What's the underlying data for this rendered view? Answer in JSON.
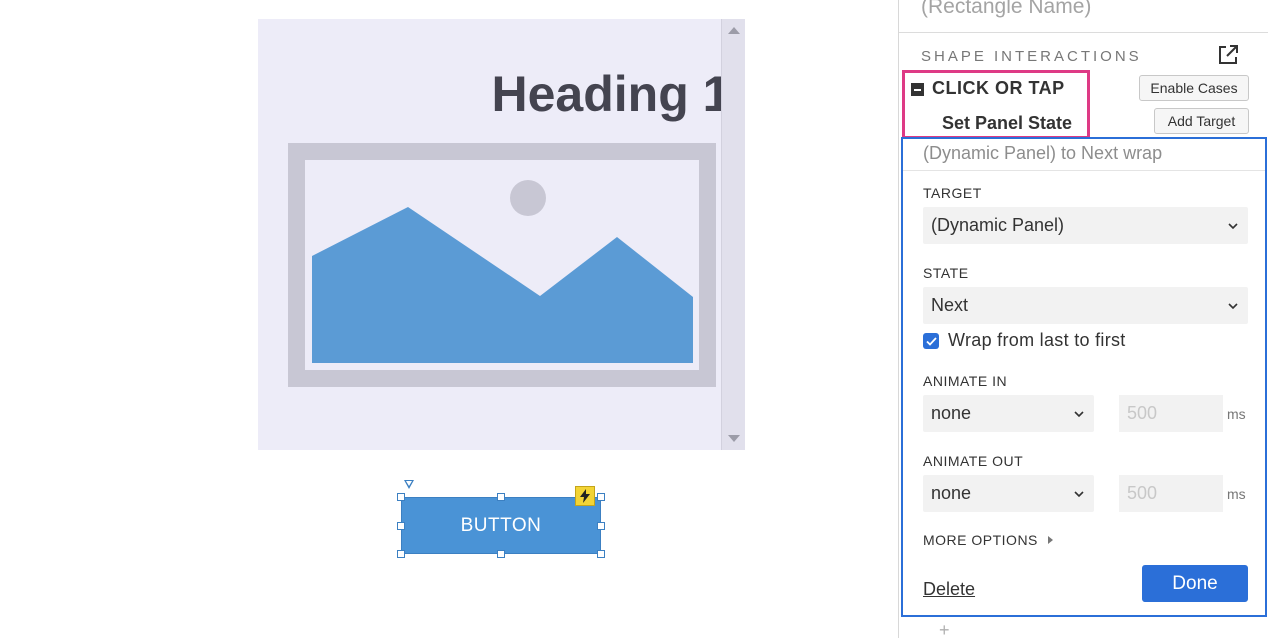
{
  "canvas": {
    "dynamic_panel": {
      "heading": "Heading 1"
    },
    "button": {
      "label": "BUTTON"
    }
  },
  "right_panel": {
    "shape_name_placeholder": "(Rectangle Name)",
    "section_title": "SHAPE INTERACTIONS",
    "event": {
      "label": "CLICK OR TAP",
      "action": "Set Panel State"
    },
    "enable_cases_label": "Enable Cases",
    "add_target_label": "Add Target",
    "editor": {
      "summary": "(Dynamic Panel) to Next wrap",
      "target_label": "TARGET",
      "target_value": "(Dynamic Panel)",
      "state_label": "STATE",
      "state_value": "Next",
      "wrap_checked": true,
      "wrap_label": "Wrap from last to first",
      "animate_in_label": "ANIMATE IN",
      "animate_in_value": "none",
      "animate_in_ms": "500",
      "animate_out_label": "ANIMATE OUT",
      "animate_out_value": "none",
      "animate_out_ms": "500",
      "ms_unit": "ms",
      "more_options_label": "MORE OPTIONS",
      "delete_label": "Delete",
      "done_label": "Done"
    },
    "add_plus": "+"
  },
  "colors": {
    "accent_blue": "#2b6fd8",
    "highlight_pink": "#de3a85",
    "widget_blue": "#4a93d6",
    "panel_bg": "#edecf8",
    "image_blue": "#5b9bd5",
    "badge_yellow": "#f3d435"
  },
  "icons": {
    "popout": "external-link-icon",
    "collapse": "minus-square-icon",
    "chevron": "chevron-down-icon",
    "check": "check-icon",
    "interaction_badge": "lightning-bolt-icon",
    "image_placeholder": "image-placeholder-icon",
    "flow_marker": "triangle-down-icon"
  }
}
